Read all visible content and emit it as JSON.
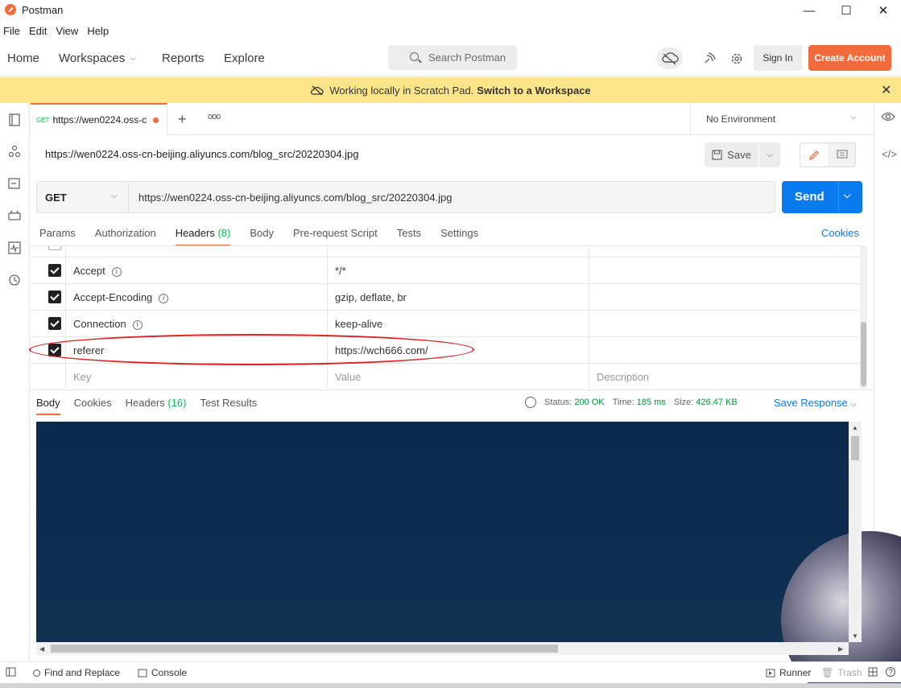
{
  "window": {
    "title": "Postman",
    "minimize": "—",
    "maximize": "☐",
    "close": "✕"
  },
  "menu": [
    "File",
    "Edit",
    "View",
    "Help"
  ],
  "header": {
    "home": "Home",
    "workspaces": "Workspaces",
    "reports": "Reports",
    "explore": "Explore",
    "search_placeholder": "Search Postman",
    "sign_in": "Sign In",
    "create_account": "Create Account"
  },
  "banner": {
    "text": "Working locally in Scratch Pad.",
    "link": "Switch to a Workspace"
  },
  "tab": {
    "method": "GET",
    "title": "https://wen0224.oss-c"
  },
  "environment": {
    "selected": "No Environment"
  },
  "request": {
    "name": "https://wen0224.oss-cn-beijing.aliyuncs.com/blog_src/20220304.jpg",
    "method": "GET",
    "url": "https://wen0224.oss-cn-beijing.aliyuncs.com/blog_src/20220304.jpg",
    "save": "Save",
    "send": "Send"
  },
  "request_tabs": [
    {
      "label": "Params"
    },
    {
      "label": "Authorization"
    },
    {
      "label": "Headers",
      "count": "(8)"
    },
    {
      "label": "Body"
    },
    {
      "label": "Pre-request Script"
    },
    {
      "label": "Tests"
    },
    {
      "label": "Settings"
    }
  ],
  "cookies_link": "Cookies",
  "headers": [
    {
      "key": "Accept",
      "value": "*/*",
      "checked": true
    },
    {
      "key": "Accept-Encoding",
      "value": "gzip, deflate, br",
      "checked": true
    },
    {
      "key": "Connection",
      "value": "keep-alive",
      "checked": true
    },
    {
      "key": "referer",
      "value": "https://wch666.com/",
      "checked": true
    }
  ],
  "headers_placeholder": {
    "key": "Key",
    "value": "Value",
    "description": "Description"
  },
  "response_tabs": [
    {
      "label": "Body"
    },
    {
      "label": "Cookies"
    },
    {
      "label": "Headers",
      "count": "(16)"
    },
    {
      "label": "Test Results"
    }
  ],
  "response_status": {
    "status_label": "Status:",
    "status": "200 OK",
    "time_label": "Time:",
    "time": "185 ms",
    "size_label": "Size:",
    "size": "426.47 KB"
  },
  "save_response": "Save Response",
  "footer": {
    "find_replace": "Find and Replace",
    "console": "Console",
    "runner": "Runner",
    "trash": "Trash"
  },
  "colors": {
    "accent": "#f26b3a",
    "send": "#097bed",
    "banner": "#fde68a",
    "success": "#0cbb52",
    "annotation": "#dd2222"
  }
}
